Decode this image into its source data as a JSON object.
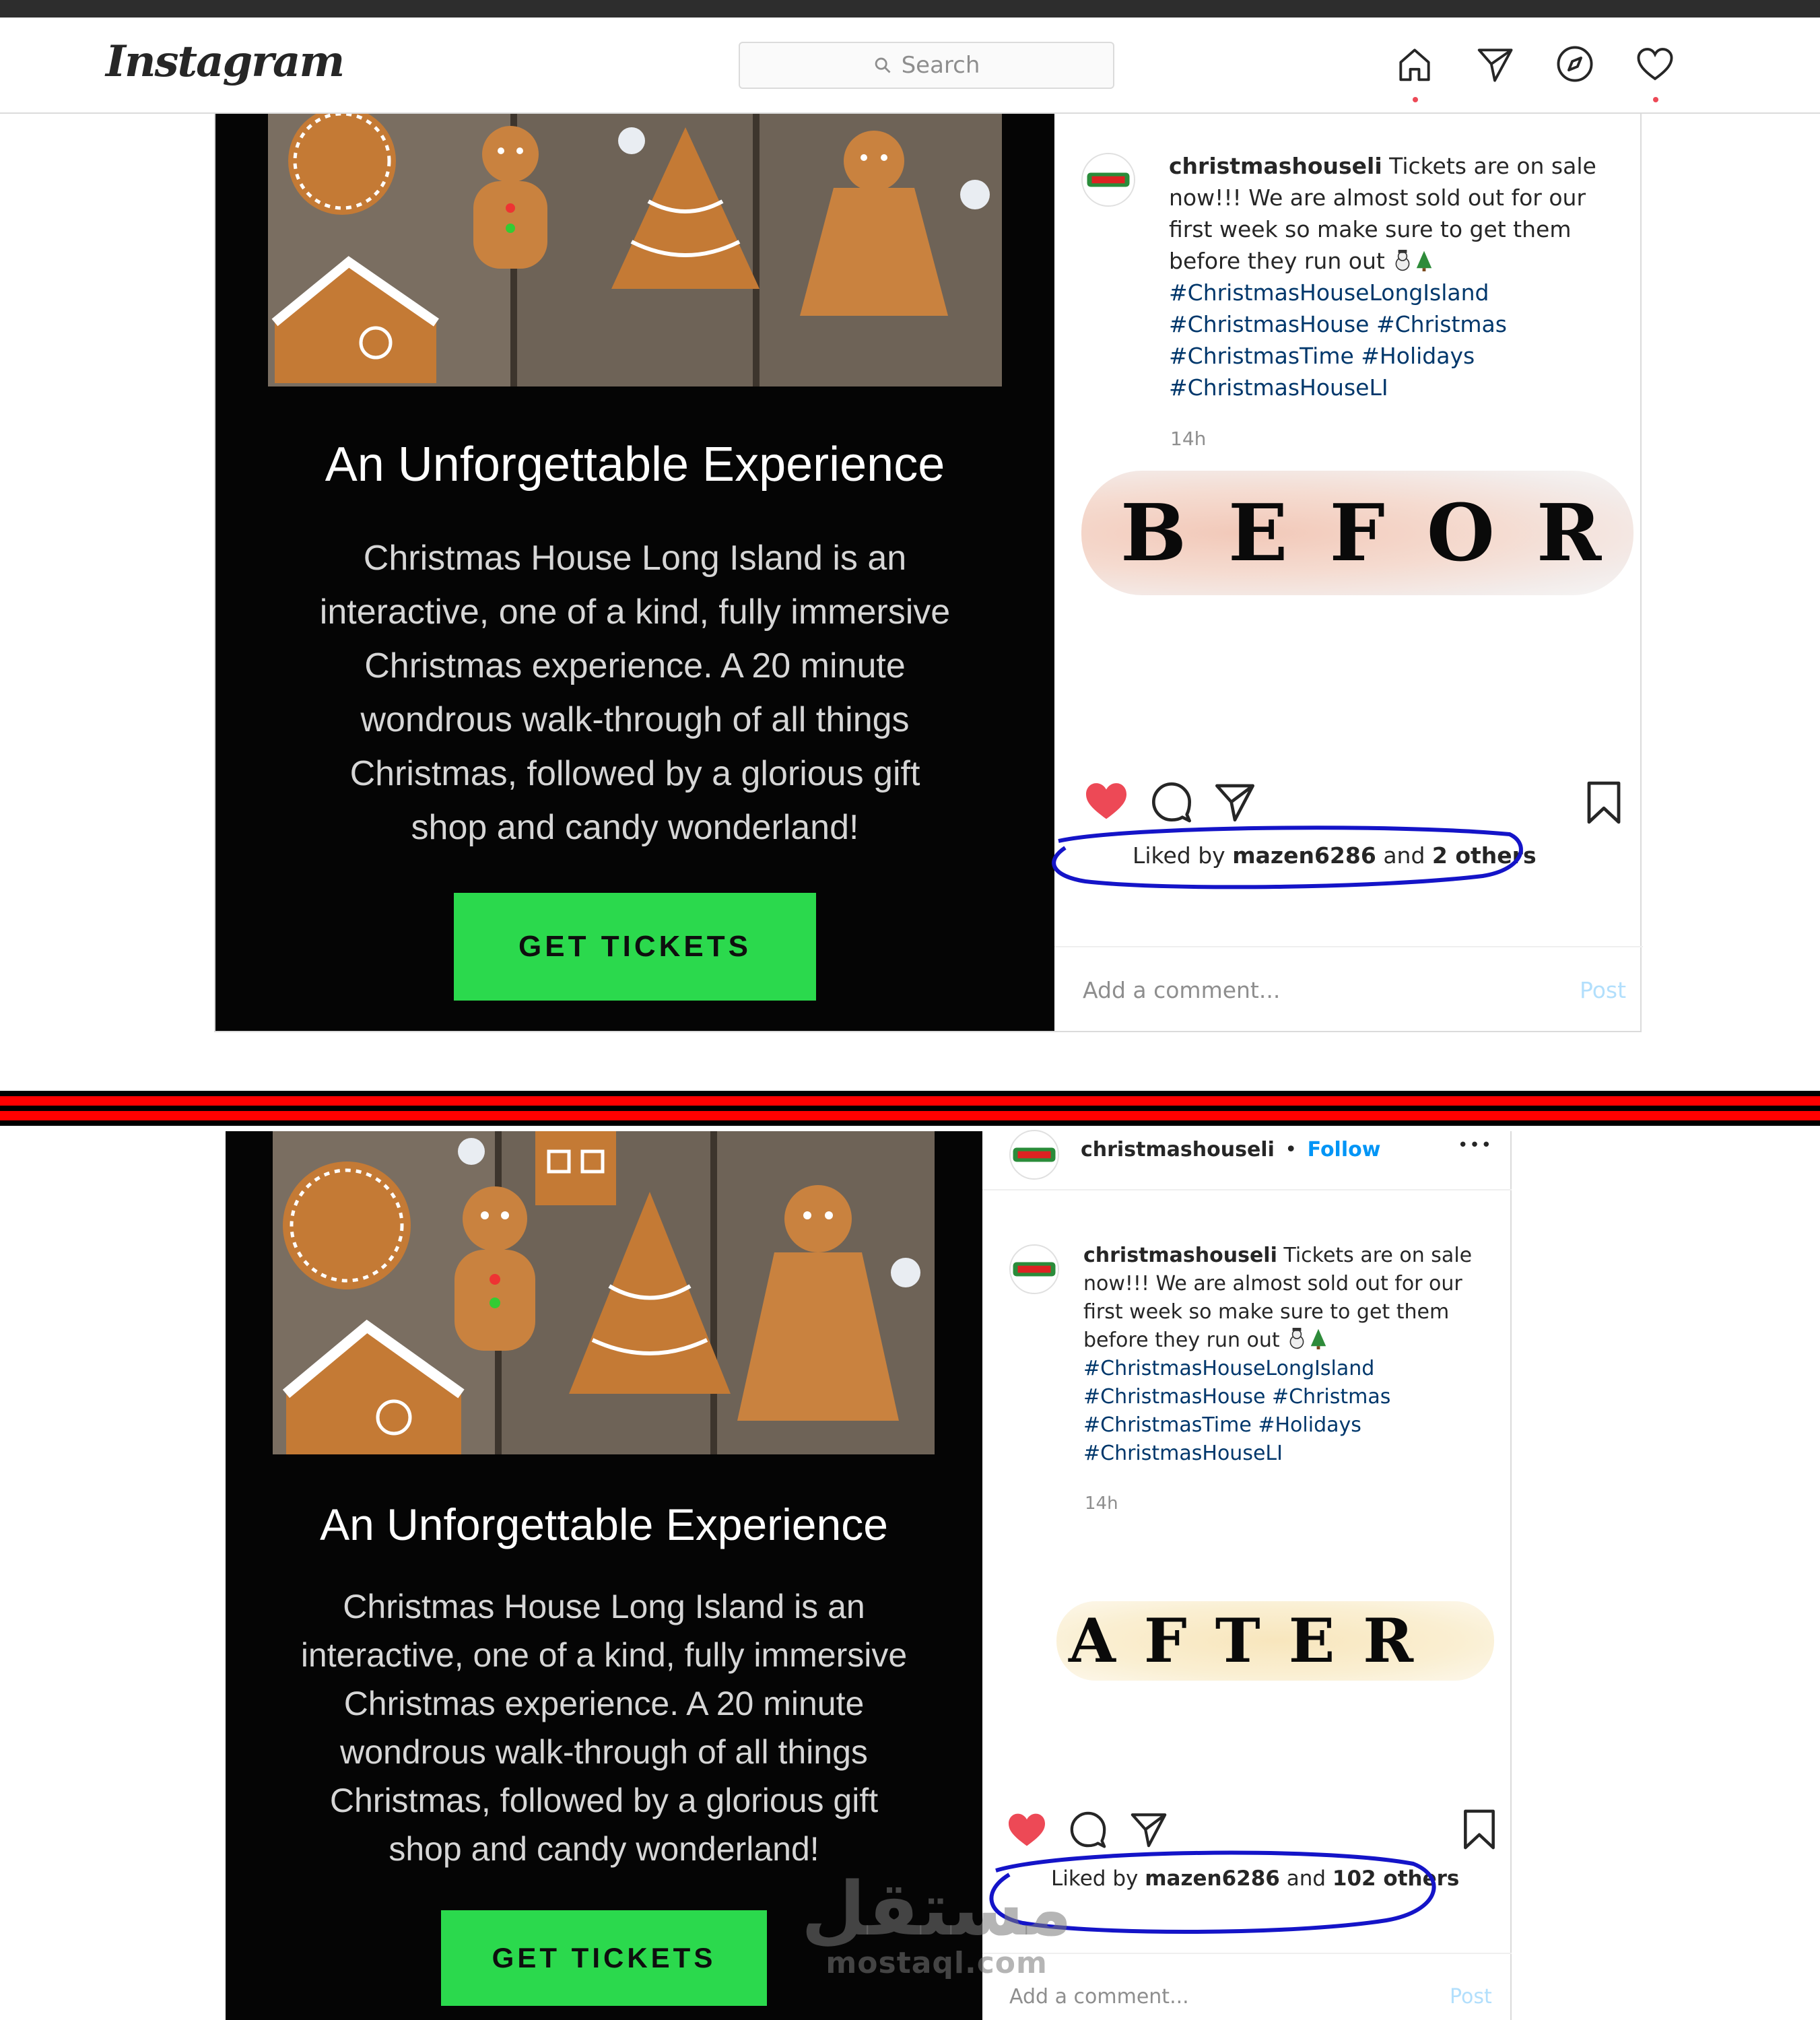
{
  "header": {
    "logo": "Instagram",
    "search_placeholder": "Search",
    "nav_icons": [
      "home-icon",
      "direct-icon",
      "explore-icon",
      "activity-heart-icon"
    ]
  },
  "colors": {
    "cta_green": "#2bd94d",
    "hashtag": "#00376b",
    "like_red": "#ed4956",
    "follow_blue": "#0095f6",
    "marker_blue": "#1414c8",
    "divider_red": "#ff0000"
  },
  "media": {
    "title": "An Unforgettable Experience",
    "body_lines": [
      "Christmas House Long Island is an",
      "interactive, one of a kind, fully immersive",
      "Christmas experience.  A 20 minute",
      "wondrous walk-through of all things",
      "Christmas, followed by a glorious gift",
      "shop and candy wonderland!"
    ],
    "cta": "GET TICKETS"
  },
  "before": {
    "stamp": "BEFOR",
    "caption": {
      "user": "christmashouseli",
      "text_lines": [
        "Tickets are on sale",
        "now!!! We are almost sold out for our",
        "first week so make sure to get them",
        "before they run out"
      ],
      "hashtags": [
        "#ChristmasHouseLongIsland",
        "#ChristmasHouse #Christmas",
        "#ChristmasTime #Holidays",
        "#ChristmasHouseLI"
      ]
    },
    "time": "14h",
    "likes": {
      "prefix": "Liked by",
      "user": "mazen6286",
      "mid": "and",
      "count": "2 others"
    },
    "comment_placeholder": "Add a comment...",
    "post_label": "Post"
  },
  "after": {
    "stamp": "AFTER",
    "header_user": "christmashouseli",
    "follow": "Follow",
    "more": "•••",
    "caption": {
      "user": "christmashouseli",
      "text_lines": [
        "Tickets are on sale",
        "now!!! We are almost sold out for our",
        "first week so make sure to get them",
        "before they run out"
      ],
      "hashtags": [
        "#ChristmasHouseLongIsland",
        "#ChristmasHouse #Christmas",
        "#ChristmasTime #Holidays",
        "#ChristmasHouseLI"
      ]
    },
    "time": "14h",
    "likes": {
      "prefix": "Liked by",
      "user": "mazen6286",
      "mid": "and",
      "count": "102 others"
    },
    "comment_placeholder": "Add a comment...",
    "post_label": "Post"
  },
  "watermark": {
    "arabic": "مستقل",
    "latin": "mostaql.com"
  }
}
